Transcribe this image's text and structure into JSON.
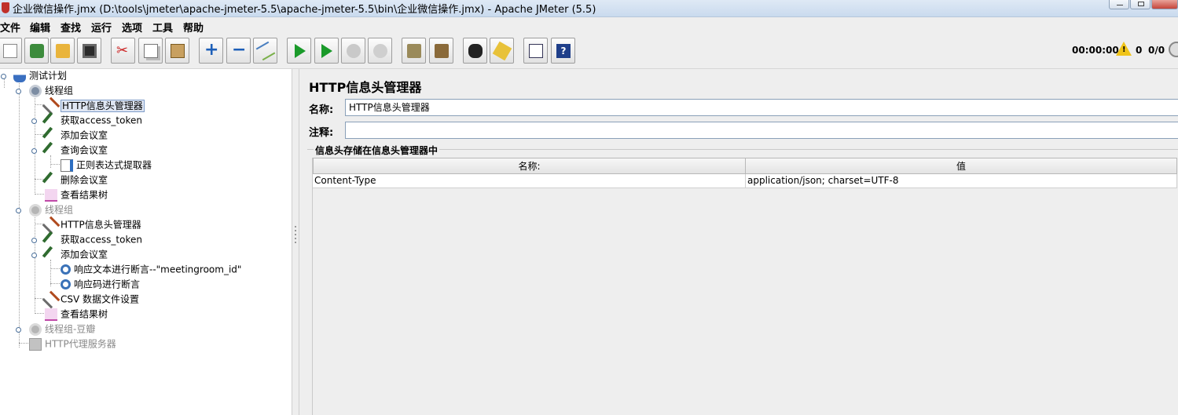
{
  "window": {
    "title": "企业微信操作.jmx (D:\\tools\\jmeter\\apache-jmeter-5.5\\apache-jmeter-5.5\\bin\\企业微信操作.jmx) - Apache JMeter (5.5)"
  },
  "menu": [
    "文件",
    "编辑",
    "查找",
    "运行",
    "选项",
    "工具",
    "帮助"
  ],
  "toolbar": {
    "buttons": [
      "new-icon",
      "templates-icon",
      "open-icon",
      "save-icon",
      "cut-icon",
      "copy-icon",
      "paste-icon",
      "expand-icon",
      "collapse-icon",
      "toggle-icon",
      "start-icon",
      "start-no-pause-icon",
      "stop-icon",
      "shutdown-icon",
      "clear-icon",
      "clear-all-icon",
      "search-icon",
      "reset-search-icon",
      "function-helper-icon",
      "help-icon"
    ],
    "timer": "00:00:00",
    "error_count": "0",
    "thread_count": "0/0"
  },
  "tree": {
    "nodes": [
      {
        "label": "测试计划",
        "icon": "test-plan-icon"
      },
      {
        "label": "线程组",
        "icon": "thread-group-icon"
      },
      {
        "label": "HTTP信息头管理器",
        "icon": "config-tool-icon"
      },
      {
        "label": "获取access_token",
        "icon": "sampler-icon"
      },
      {
        "label": "添加会议室",
        "icon": "sampler-icon"
      },
      {
        "label": "查询会议室",
        "icon": "sampler-icon"
      },
      {
        "label": "正则表达式提取器",
        "icon": "extractor-icon"
      },
      {
        "label": "删除会议室",
        "icon": "sampler-icon"
      },
      {
        "label": "查看结果树",
        "icon": "listener-icon"
      },
      {
        "label": "线程组",
        "icon": "thread-group-icon"
      },
      {
        "label": "HTTP信息头管理器",
        "icon": "config-tool-icon"
      },
      {
        "label": "获取access_token",
        "icon": "sampler-icon"
      },
      {
        "label": "添加会议室",
        "icon": "sampler-icon"
      },
      {
        "label": "响应文本进行断言--\"meetingroom_id\"",
        "icon": "assertion-icon"
      },
      {
        "label": "响应码进行断言",
        "icon": "assertion-icon"
      },
      {
        "label": "CSV 数据文件设置",
        "icon": "config-tool-icon"
      },
      {
        "label": "查看结果树",
        "icon": "listener-icon"
      },
      {
        "label": "线程组-豆瓣",
        "icon": "thread-group-icon"
      },
      {
        "label": "HTTP代理服务器",
        "icon": "proxy-icon"
      }
    ]
  },
  "panel": {
    "title": "HTTP信息头管理器",
    "name_label": "名称:",
    "name_value": "HTTP信息头管理器",
    "comment_label": "注释:",
    "comment_value": "",
    "group_title": "信息头存储在信息头管理器中",
    "table": {
      "headers": [
        "名称:",
        "值"
      ],
      "rows": [
        [
          "Content-Type",
          "application/json; charset=UTF-8"
        ]
      ]
    }
  }
}
